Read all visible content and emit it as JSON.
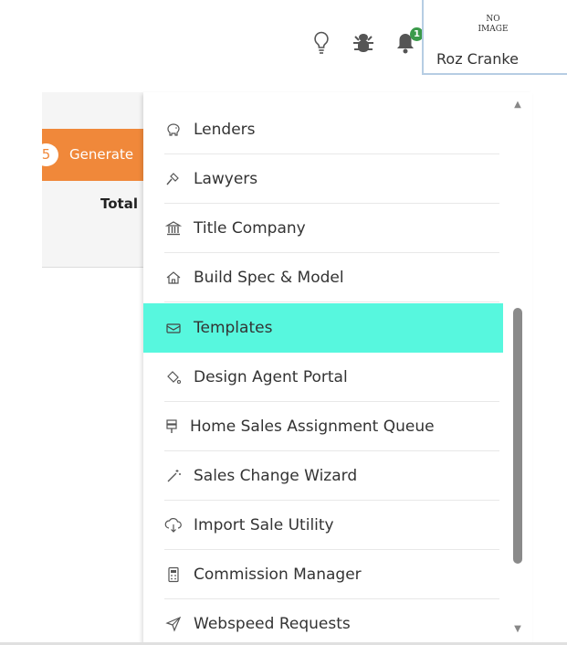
{
  "header": {
    "icons": [
      "lightbulb-icon",
      "bug-icon",
      "bell-icon"
    ],
    "notification_count": "1",
    "avatar": {
      "placeholder_line1": "NO",
      "placeholder_line2": "IMAGE",
      "user_name": "Roz Cranke"
    }
  },
  "background": {
    "generate_button": {
      "count": "5",
      "label": "Generate"
    },
    "total_label": "Total"
  },
  "menu": {
    "active_color": "#57f7de",
    "items": [
      {
        "label": "Lenders",
        "icon": "piggy-bank-icon"
      },
      {
        "label": "Lawyers",
        "icon": "gavel-icon"
      },
      {
        "label": "Title Company",
        "icon": "bank-building-icon"
      },
      {
        "label": "Build Spec & Model",
        "icon": "house-icon"
      },
      {
        "label": "Templates",
        "icon": "envelope-icon",
        "active": true
      },
      {
        "label": "Design Agent Portal",
        "icon": "paint-bucket-icon"
      },
      {
        "label": "Home Sales Assignment Queue",
        "icon": "signpost-icon"
      },
      {
        "label": "Sales Change Wizard",
        "icon": "magic-wand-icon"
      },
      {
        "label": "Import Sale Utility",
        "icon": "cloud-download-icon"
      },
      {
        "label": "Commission Manager",
        "icon": "calculator-icon"
      },
      {
        "label": "Webspeed Requests",
        "icon": "paper-plane-icon"
      }
    ]
  }
}
